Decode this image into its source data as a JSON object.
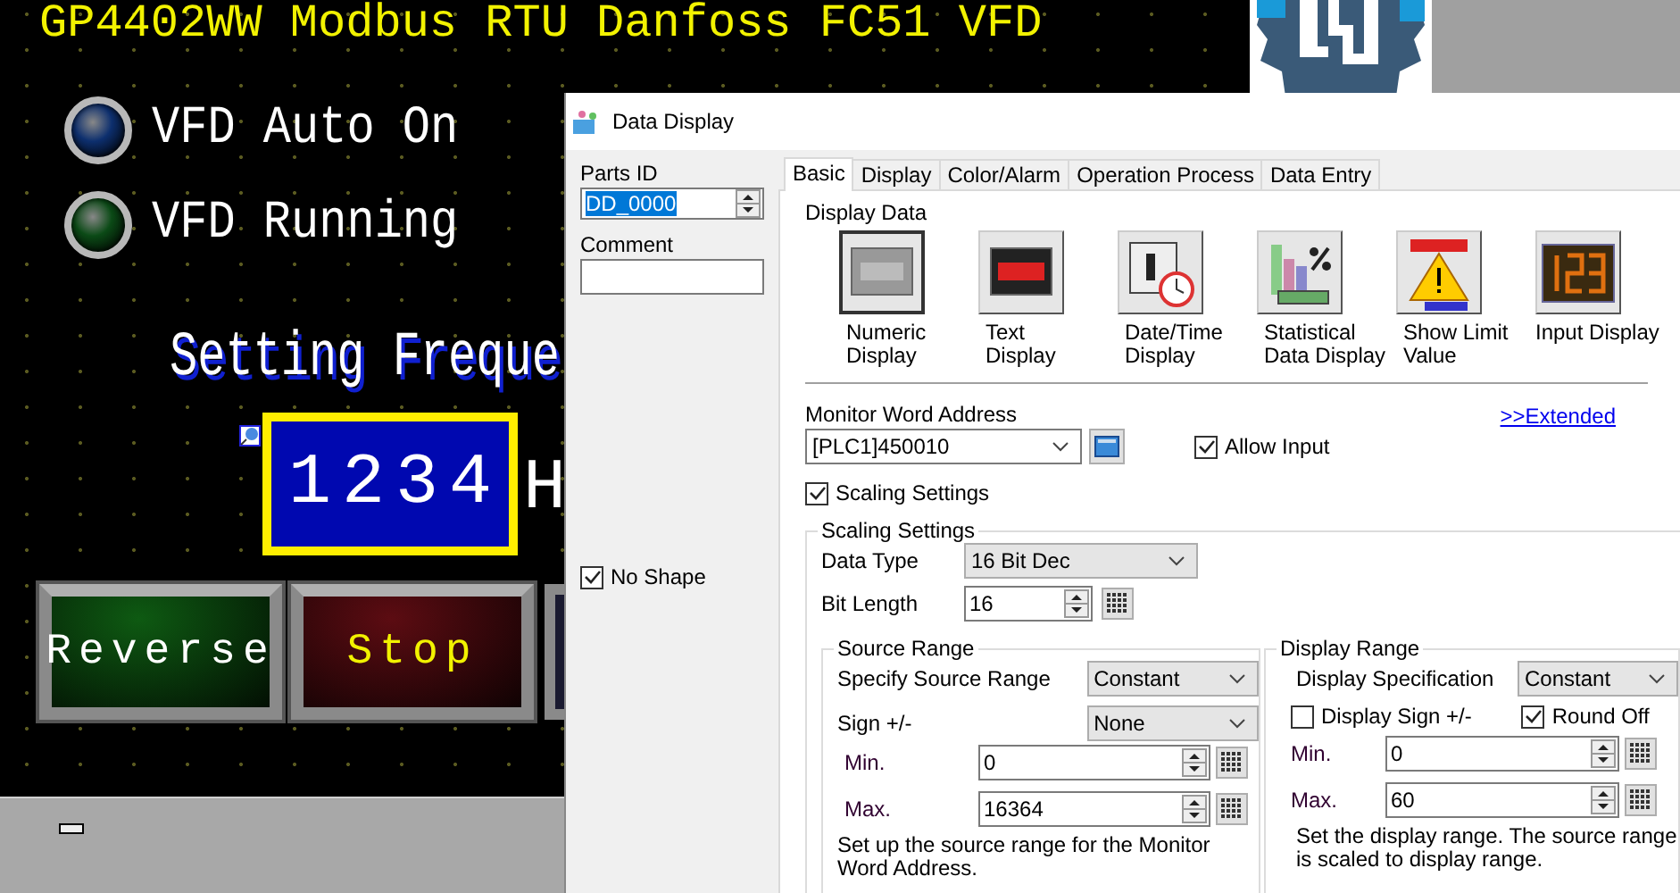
{
  "canvas": {
    "title": "GP4402WW  Modbus RTU  Danfoss FC51 VFD",
    "lamps": [
      {
        "label": "VFD Auto On",
        "color": "#0d2f6e"
      },
      {
        "label": "VFD Running",
        "color": "#0b4a16"
      }
    ],
    "setting_label": "Setting Freque",
    "numeric_value": "1234",
    "unit": "H",
    "buttons": [
      {
        "label": "Reverse",
        "color": "#0e5a12"
      },
      {
        "label": "Stop",
        "color": "#5c0c12"
      }
    ]
  },
  "dialog": {
    "title": "Data Display",
    "parts_id_label": "Parts ID",
    "parts_id": "DD_0000",
    "comment_label": "Comment",
    "no_shape": {
      "label": "No Shape",
      "checked": true
    },
    "tabs": [
      {
        "label": "Basic",
        "selected": true
      },
      {
        "label": "Display",
        "selected": false
      },
      {
        "label": "Color/Alarm",
        "selected": false
      },
      {
        "label": "Operation Process",
        "selected": false
      },
      {
        "label": "Data Entry",
        "selected": false
      }
    ],
    "display_data_label": "Display Data",
    "display_types": [
      {
        "label": "Numeric\nDisplay",
        "kind": "numeric",
        "selected": true
      },
      {
        "label": "Text\nDisplay",
        "kind": "text",
        "selected": false
      },
      {
        "label": "Date/Time\nDisplay",
        "kind": "datetime",
        "selected": false
      },
      {
        "label": "Statistical\nData Display",
        "kind": "statistics",
        "selected": false
      },
      {
        "label": "Show Limit\nValue",
        "kind": "limit",
        "selected": false
      },
      {
        "label": "Input Display",
        "kind": "input",
        "selected": false
      }
    ],
    "monitor_label": "Monitor Word Address",
    "monitor_address": "[PLC1]450010",
    "extended_link": ">>Extended",
    "allow_input": {
      "label": "Allow Input",
      "checked": true
    },
    "scaling_checkbox": {
      "label": "Scaling Settings",
      "checked": true
    },
    "scaling": {
      "title": "Scaling Settings",
      "data_type_label": "Data Type",
      "data_type": "16 Bit Dec",
      "bit_length_label": "Bit Length",
      "bit_length": "16",
      "source_range": {
        "title": "Source Range",
        "specify_label": "Specify Source Range",
        "specify": "Constant",
        "sign_label": "Sign +/-",
        "sign": "None",
        "min_label": "Min.",
        "min": "0",
        "max_label": "Max.",
        "max": "16364",
        "note": "Set up the source range for the Monitor Word Address."
      },
      "display_range": {
        "title": "Display Range",
        "spec_label": "Display Specification",
        "spec": "Constant",
        "display_sign": {
          "label": "Display Sign +/-",
          "checked": false
        },
        "round_off": {
          "label": "Round Off",
          "checked": true
        },
        "min_label": "Min.",
        "min": "0",
        "max_label": "Max.",
        "max": "60",
        "note": "Set the display range. The source range is scaled to display range."
      }
    }
  }
}
